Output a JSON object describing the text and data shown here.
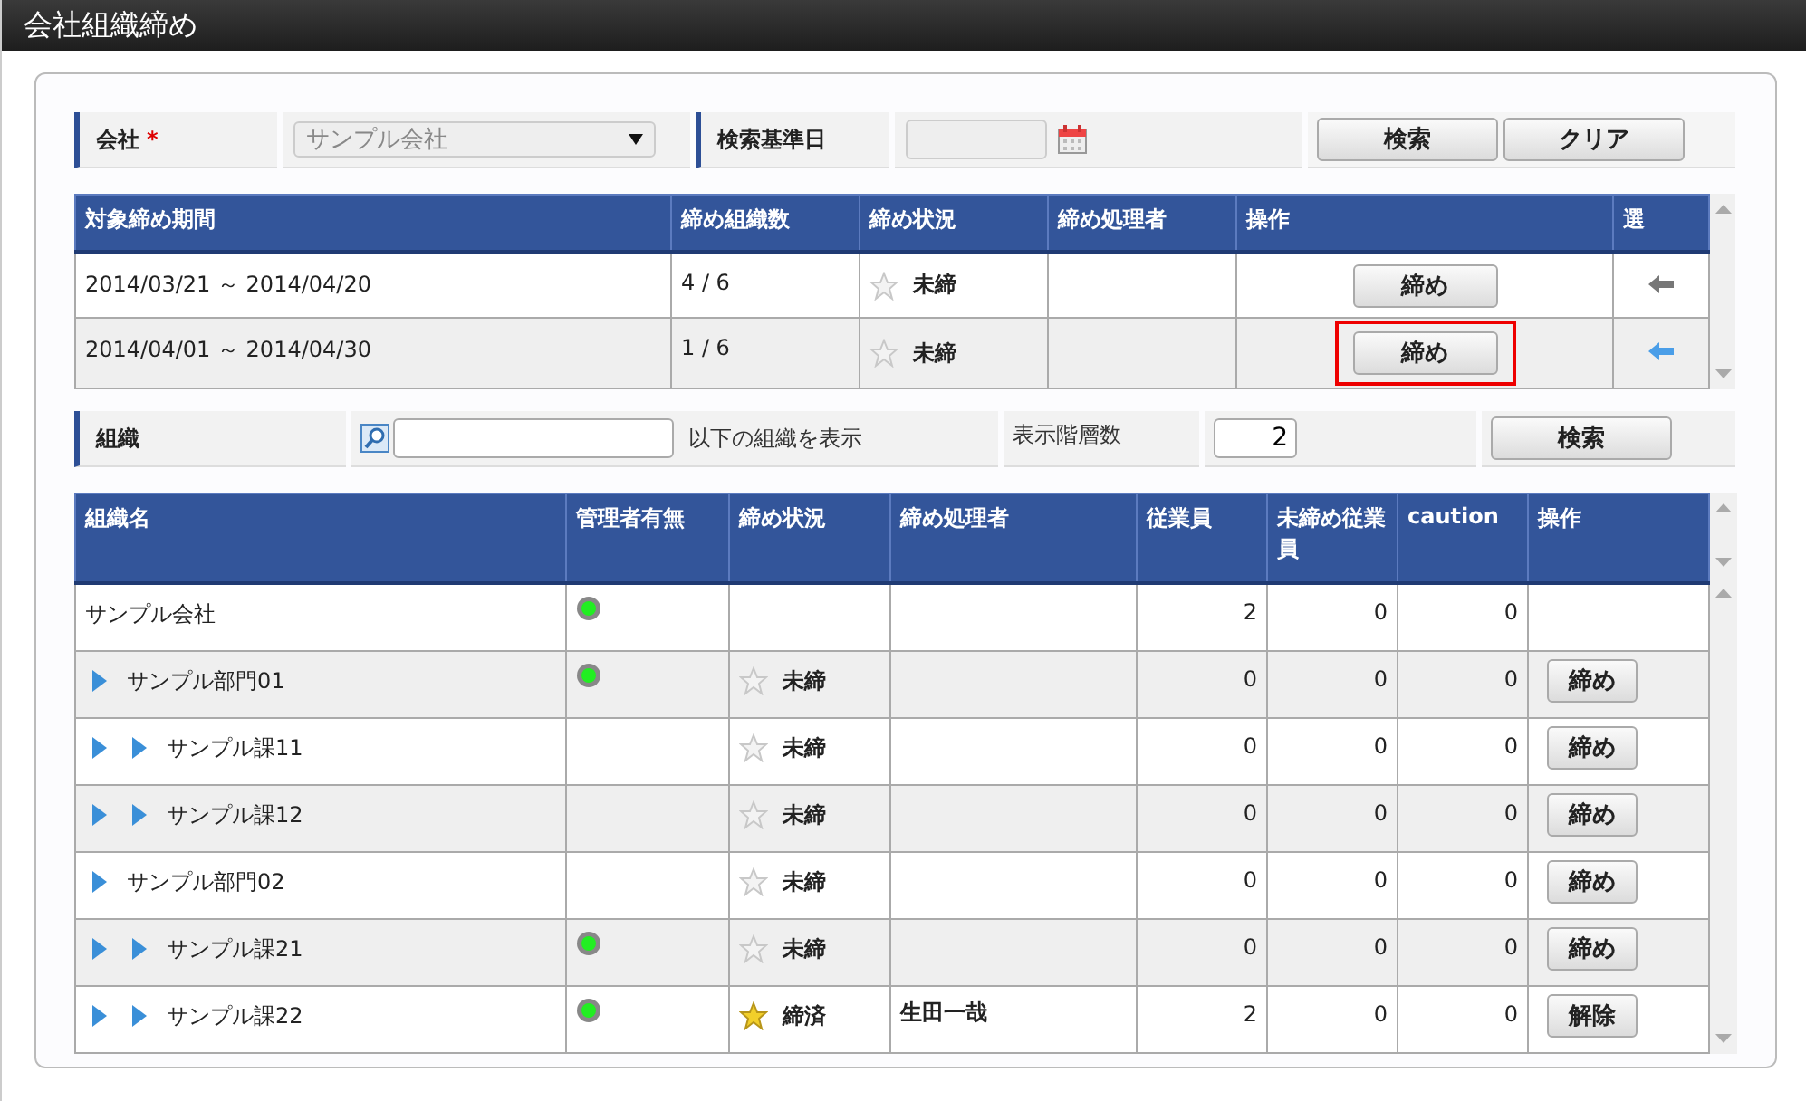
{
  "window": {
    "title": "会社組織締め"
  },
  "search_form": {
    "company_label": "会社",
    "required_mark": "*",
    "company_value": "サンプル会社",
    "date_label": "検索基準日",
    "search_button": "検索",
    "clear_button": "クリア"
  },
  "period_table": {
    "columns": [
      "対象締め期間",
      "締め組織数",
      "締め状況",
      "締め処理者",
      "操作",
      "選"
    ],
    "rows": [
      {
        "period": "2014/03/21 ～ 2014/04/20",
        "count": "4 / 6",
        "closed": false,
        "status": "未締",
        "action": "締め",
        "highlighted": false,
        "selected": false
      },
      {
        "period": "2014/04/01 ～ 2014/04/30",
        "count": "1 / 6",
        "closed": false,
        "status": "未締",
        "action": "締め",
        "highlighted": true,
        "selected": true
      }
    ]
  },
  "org_form": {
    "label": "組織",
    "suffix": "以下の組織を表示",
    "depth_label": "表示階層数",
    "depth_value": "2",
    "search_button": "検索"
  },
  "org_table": {
    "columns": [
      "組織名",
      "管理者有無",
      "締め状況",
      "締め処理者",
      "従業員",
      "未締め従業員",
      "caution",
      "操作"
    ],
    "rows": [
      {
        "name": "サンプル会社",
        "has_admin": true,
        "employees": "2",
        "unclosed": "0",
        "caution": "0",
        "children": [
          {
            "name": "サンプル部門01",
            "has_admin": true,
            "closed": false,
            "status": "未締",
            "employees": "0",
            "unclosed": "0",
            "caution": "0",
            "action": "締め",
            "children": [
              {
                "name": "サンプル課11",
                "has_admin": false,
                "closed": false,
                "status": "未締",
                "employees": "0",
                "unclosed": "0",
                "caution": "0",
                "action": "締め"
              },
              {
                "name": "サンプル課12",
                "has_admin": false,
                "closed": false,
                "status": "未締",
                "employees": "0",
                "unclosed": "0",
                "caution": "0",
                "action": "締め"
              }
            ]
          },
          {
            "name": "サンプル部門02",
            "has_admin": false,
            "closed": false,
            "status": "未締",
            "employees": "0",
            "unclosed": "0",
            "caution": "0",
            "action": "締め",
            "children": [
              {
                "name": "サンプル課21",
                "has_admin": true,
                "closed": false,
                "status": "未締",
                "employees": "0",
                "unclosed": "0",
                "caution": "0",
                "action": "締め"
              },
              {
                "name": "サンプル課22",
                "has_admin": true,
                "closed": true,
                "status": "締済",
                "closer": "生田一哉",
                "employees": "2",
                "unclosed": "0",
                "caution": "0",
                "action": "解除"
              }
            ]
          }
        ]
      }
    ]
  }
}
